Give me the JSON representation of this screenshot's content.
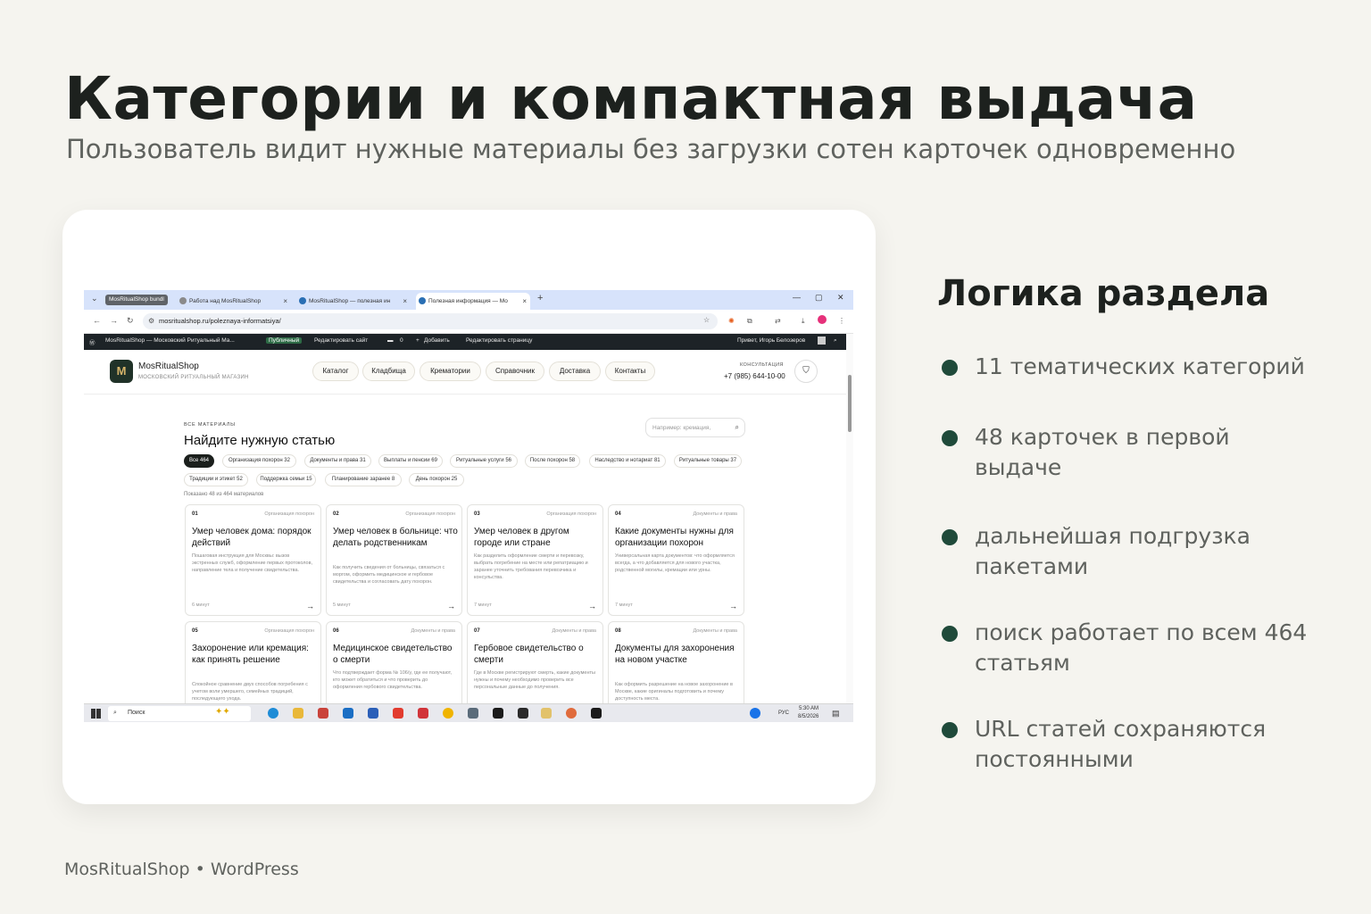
{
  "slide": {
    "title": "Категории и компактная выдача",
    "subtitle": "Пользователь видит нужные материалы без загрузки сотен карточек одновременно",
    "footer": "MosRitualShop • WordPress"
  },
  "panel": {
    "title": "Логика раздела",
    "bullets": [
      "11 тематических категорий",
      "48 карточек в первой выдаче",
      "дальнейшая подгрузка пакетами",
      "поиск работает по всем 464 статьям",
      "URL статей сохраняются постоянными"
    ],
    "accent": "#1f4a3a"
  },
  "browser": {
    "tab_group": "MosRitualShop bundl",
    "tabs": [
      "Работа над MosRitualShop",
      "MosRitualShop — полезная ин",
      "Полезная информация — Mo"
    ],
    "url": "mosritualshop.ru/poleznaya-informatsiya/"
  },
  "wpbar": {
    "site": "MosRitualShop — Московский Ритуальный Ма...",
    "status": "Публичный",
    "edit_site": "Редактировать сайт",
    "comments": "0",
    "add": "Добавить",
    "edit_page": "Редактировать страницу",
    "greeting": "Привет, Игорь Белозеров"
  },
  "site": {
    "logo_letter": "M",
    "logo_name": "MosRitualShop",
    "logo_sub": "МОСКОВСКИЙ РИТУАЛЬНЫЙ МАГАЗИН",
    "menu": [
      "Каталог",
      "Кладбища",
      "Крематории",
      "Справочник",
      "Доставка",
      "Контакты"
    ],
    "consult_label": "КОНСУЛЬТАЦИЯ",
    "phone": "+7 (985) 644-10-00"
  },
  "content": {
    "eyebrow": "ВСЕ МАТЕРИАЛЫ",
    "heading": "Найдите нужную статью",
    "search_placeholder": "Например: кремация,",
    "chips": [
      "Все 464",
      "Организация похорон 32",
      "Документы и права 31",
      "Выплаты и пенсии 69",
      "Ритуальные услуги 56",
      "После похорон 58",
      "Наследство и нотариат 81",
      "Ритуальные товары 37",
      "Традиции и этикет 52",
      "Поддержка семьи 15",
      "Планирование заранее 8",
      "День похорон 25"
    ],
    "shown": "Показано 48 из 464 материалов",
    "cards": [
      {
        "num": "01",
        "cat": "Организация похорон",
        "title": "Умер человек дома: порядок действий",
        "desc": "Пошаговая инструкция для Москвы: вызов экстренных служб, оформление первых протоколов, направление тела и получение свидетельства.",
        "time": "6 минут"
      },
      {
        "num": "02",
        "cat": "Организация похорон",
        "title": "Умер человек в больнице: что делать родственникам",
        "desc": "Как получить сведения от больницы, связаться с моргом, оформить медицинское и гербовое свидетельства и согласовать дату похорон.",
        "time": "5 минут"
      },
      {
        "num": "03",
        "cat": "Организация похорон",
        "title": "Умер человек в другом городе или стране",
        "desc": "Как разделить оформление смерти и перевозку, выбрать погребение на месте или репатриацию и заранее уточнить требования перевозчика и консульства.",
        "time": "7 минут"
      },
      {
        "num": "04",
        "cat": "Документы и права",
        "title": "Какие документы нужны для организации похорон",
        "desc": "Универсальная карта документов: что оформляется всегда, а что добавляется для нового участка, родственной могилы, кремации или урны.",
        "time": "7 минут"
      },
      {
        "num": "05",
        "cat": "Организация похорон",
        "title": "Захоронение или кремация: как принять решение",
        "desc": "Спокойное сравнение двух способов погребения с учетом воли умершего, семейных традиций, последующего ухода.",
        "time": ""
      },
      {
        "num": "06",
        "cat": "Документы и права",
        "title": "Медицинское свидетельство о смерти",
        "desc": "Что подтверждает форма № 106/у, где ее получают, кто может обратиться и что проверить до оформления гербового свидетельства.",
        "time": ""
      },
      {
        "num": "07",
        "cat": "Документы и права",
        "title": "Гербовое свидетельство о смерти",
        "desc": "Где в Москве регистрируют смерть, какие документы нужны и почему необходимо проверить все персональные данные до получения.",
        "time": ""
      },
      {
        "num": "08",
        "cat": "Документы и права",
        "title": "Документы для захоронения на новом участке",
        "desc": "Как оформить разрешение на новое захоронение в Москве, какие оригиналы подготовить и почему доступность места.",
        "time": ""
      }
    ]
  },
  "taskbar": {
    "search": "Поиск",
    "lang": "РУС",
    "time": "5:30 AM",
    "date": "8/5/2026"
  }
}
